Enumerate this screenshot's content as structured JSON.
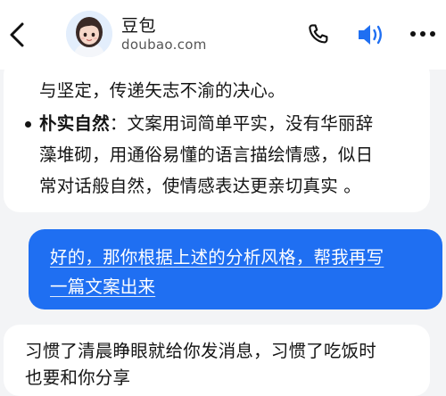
{
  "header": {
    "bot_name": "豆包",
    "bot_domain": "doubao.com",
    "icons": {
      "back": "chevron-left-icon",
      "phone": "phone-icon",
      "voice": "speaker-icon",
      "more": "more-horizontal-icon"
    },
    "accent_color": "#1f6ff2"
  },
  "conversation": {
    "bot_message_1": {
      "line_1": "与坚定，传递矢志不渝的决心。",
      "bullet_term": "朴实自然",
      "bullet_text": "：文案用词简单平实，没有华丽辞",
      "line_3": "藻堆砌，用通俗易懂的语言描绘情感，似日",
      "line_4": "常对话般自然，使情感表达更亲切真实 。"
    },
    "user_message": {
      "line_1": "好的，那你根据上述的分析风格，帮我再写",
      "line_2": "一篇文案出来"
    },
    "bot_message_2": {
      "line_1": "习惯了清晨睁眼就给你发消息，习惯了吃饭时",
      "line_2": "也要和你分享"
    }
  }
}
